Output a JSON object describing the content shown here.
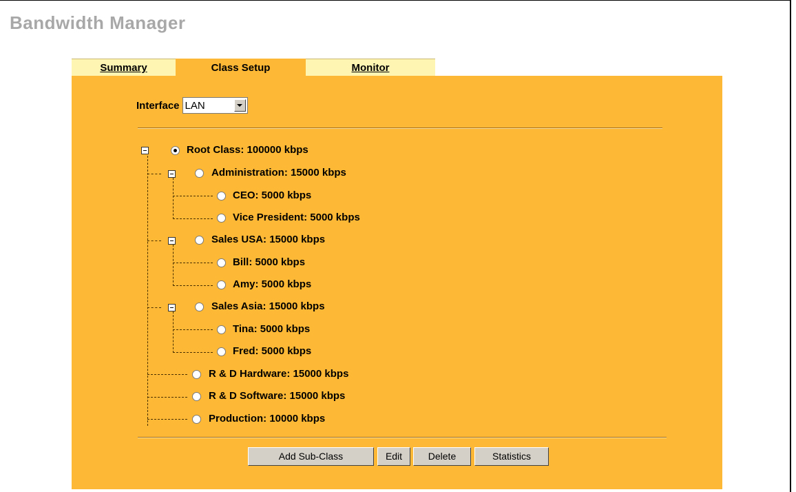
{
  "page_title": "Bandwidth Manager",
  "tabs": [
    {
      "label": "Summary"
    },
    {
      "label": "Class Setup"
    },
    {
      "label": "Monitor"
    }
  ],
  "interface": {
    "label": "Interface",
    "value": "LAN"
  },
  "tree": {
    "root": "Root Class: 100000 kbps",
    "administration": "Administration: 15000 kbps",
    "ceo": "CEO: 5000 kbps",
    "vice_president": "Vice President: 5000 kbps",
    "sales_usa": "Sales USA: 15000 kbps",
    "bill": "Bill: 5000 kbps",
    "amy": "Amy: 5000 kbps",
    "sales_asia": "Sales Asia: 15000 kbps",
    "tina": "Tina: 5000 kbps",
    "fred": "Fred: 5000 kbps",
    "rd_hardware": "R & D Hardware: 15000 kbps",
    "rd_software": "R & D Software: 15000 kbps",
    "production": "Production: 10000 kbps"
  },
  "buttons": {
    "add_sub_class": "Add Sub-Class",
    "edit": "Edit",
    "delete": "Delete",
    "statistics": "Statistics"
  },
  "colors": {
    "panel": "#fdb835",
    "tab_inactive": "#fef5b3",
    "title": "#a8a8a8"
  }
}
